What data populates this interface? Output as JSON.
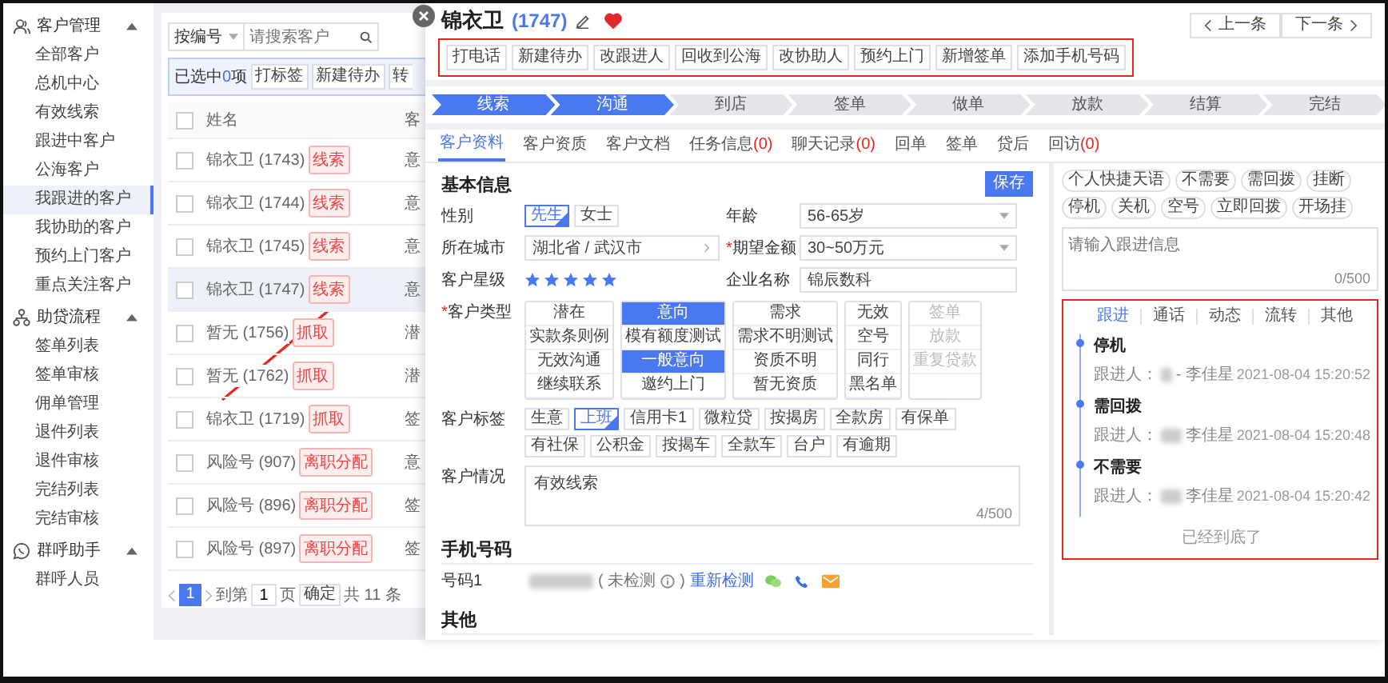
{
  "sidebar": {
    "groups": [
      {
        "title": "客户管理",
        "expanded": true,
        "items": [
          {
            "label": "全部客户",
            "selected": false
          },
          {
            "label": "总机中心",
            "selected": false
          },
          {
            "label": "有效线索",
            "selected": false
          },
          {
            "label": "跟进中客户",
            "selected": false
          },
          {
            "label": "公海客户",
            "selected": false
          },
          {
            "label": "我跟进的客户",
            "selected": true
          },
          {
            "label": "我协助的客户",
            "selected": false
          },
          {
            "label": "预约上门客户",
            "selected": false
          },
          {
            "label": "重点关注客户",
            "selected": false
          }
        ]
      },
      {
        "title": "助贷流程",
        "expanded": true,
        "items": [
          {
            "label": "签单列表",
            "selected": false
          },
          {
            "label": "签单审核",
            "selected": false
          },
          {
            "label": "佣单管理",
            "selected": false
          },
          {
            "label": "退件列表",
            "selected": false
          },
          {
            "label": "退件审核",
            "selected": false
          },
          {
            "label": "完结列表",
            "selected": false
          },
          {
            "label": "完结审核",
            "selected": false
          }
        ]
      },
      {
        "title": "群呼助手",
        "expanded": true,
        "items": [
          {
            "label": "群呼人员",
            "selected": false
          }
        ]
      }
    ]
  },
  "list": {
    "search_field": "按编号",
    "placeholder": "请搜索客户",
    "selection": {
      "text": "已选中",
      "count": "0",
      "unit": "项"
    },
    "actions": [
      "打标签",
      "新建待办",
      "转"
    ],
    "columns": [
      "姓名",
      "客"
    ],
    "select_all_checked": false,
    "rows": [
      {
        "name": "锦衣卫 (1743)",
        "tag": "线索",
        "column_3": "意",
        "checked": false,
        "selected": false
      },
      {
        "name": "锦衣卫 (1744)",
        "tag": "线索",
        "column_3": "意",
        "checked": false,
        "selected": false
      },
      {
        "name": "锦衣卫 (1745)",
        "tag": "线索",
        "column_3": "意",
        "checked": false,
        "selected": false
      },
      {
        "name": "锦衣卫 (1747)",
        "tag": "线索",
        "column_3": "意",
        "checked": false,
        "selected": true
      },
      {
        "name": "暂无 (1756)",
        "tag": "抓取",
        "column_3": "潜",
        "checked": false,
        "selected": false
      },
      {
        "name": "暂无 (1762)",
        "tag": "抓取",
        "column_3": "潜",
        "checked": false,
        "selected": false
      },
      {
        "name": "锦衣卫 (1719)",
        "tag": "抓取",
        "column_3": "签",
        "checked": false,
        "selected": false
      },
      {
        "name": "风险号 (907)",
        "tag": "离职分配",
        "column_3": "意",
        "checked": false,
        "selected": false
      },
      {
        "name": "风险号 (896)",
        "tag": "离职分配",
        "column_3": "签",
        "checked": false,
        "selected": false
      },
      {
        "name": "风险号 (897)",
        "tag": "离职分配",
        "column_3": "签",
        "checked": false,
        "selected": false
      }
    ],
    "pagination": {
      "page": "1",
      "goto_label": "到第",
      "goto_value": "1",
      "page_unit": "页",
      "confirm": "确定",
      "total": "共 11 条"
    }
  },
  "detail": {
    "title": "锦衣卫",
    "id": "(1747)",
    "favorite": true,
    "nav": [
      "上一条",
      "下一条"
    ],
    "actions": [
      "打电话",
      "新建待办",
      "改跟进人",
      "回收到公海",
      "改协助人",
      "预约上门",
      "新增签单",
      "添加手机号码"
    ],
    "steps": [
      {
        "label": "线索",
        "done": true
      },
      {
        "label": "沟通",
        "done": true
      },
      {
        "label": "到店",
        "done": false
      },
      {
        "label": "签单",
        "done": false
      },
      {
        "label": "做单",
        "done": false
      },
      {
        "label": "放款",
        "done": false
      },
      {
        "label": "结算",
        "done": false
      },
      {
        "label": "完结",
        "done": false
      }
    ],
    "tabs": [
      {
        "label": "客户资料",
        "selected": true
      },
      {
        "label": "客户资质",
        "selected": false
      },
      {
        "label": "客户文档",
        "selected": false
      },
      {
        "label": "任务信息",
        "count": "(0)",
        "selected": false
      },
      {
        "label": "聊天记录",
        "count": "(0)",
        "selected": false
      },
      {
        "label": "回单",
        "selected": false
      },
      {
        "label": "签单",
        "selected": false
      },
      {
        "label": "贷后",
        "selected": false
      },
      {
        "label": "回访",
        "count": "(0)",
        "selected": false
      }
    ],
    "form": {
      "section": "基本信息",
      "save": "保存",
      "gender": {
        "label": "性别",
        "options": [
          {
            "label": "先生",
            "selected": true
          },
          {
            "label": "女士",
            "selected": false
          }
        ]
      },
      "age": {
        "label": "年龄",
        "value": "56-65岁"
      },
      "city": {
        "label": "所在城市",
        "value": "湖北省 / 武汉市"
      },
      "amount": {
        "label": "期望金额",
        "required_mark": "*",
        "value": "30~50万元"
      },
      "rating": {
        "label": "客户星级",
        "stars": 5
      },
      "company": {
        "label": "企业名称",
        "value": "锦辰数科"
      },
      "customer_type": {
        "label": "客户类型",
        "required_mark": "*",
        "columns": [
          [
            {
              "label": "潜在",
              "selected": false,
              "disabled": false
            },
            {
              "label": "实款条则例",
              "selected": false,
              "disabled": false
            },
            {
              "label": "无效沟通",
              "selected": false,
              "disabled": false
            },
            {
              "label": "继续联系",
              "selected": false,
              "disabled": false
            }
          ],
          [
            {
              "label": "意向",
              "selected": true,
              "disabled": false
            },
            {
              "label": "模有额度测试",
              "selected": false,
              "disabled": false
            },
            {
              "label": "一般意向",
              "selected": true,
              "disabled": false
            },
            {
              "label": "邀约上门",
              "selected": false,
              "disabled": false
            }
          ],
          [
            {
              "label": "需求",
              "selected": false,
              "disabled": false
            },
            {
              "label": "需求不明测试",
              "selected": false,
              "disabled": false
            },
            {
              "label": "资质不明",
              "selected": false,
              "disabled": false
            },
            {
              "label": "暂无资质",
              "selected": false,
              "disabled": false
            }
          ],
          [
            {
              "label": "无效",
              "selected": false,
              "disabled": false
            },
            {
              "label": "空号",
              "selected": false,
              "disabled": false
            },
            {
              "label": "同行",
              "selected": false,
              "disabled": false
            },
            {
              "label": "黑名单",
              "selected": false,
              "disabled": false
            }
          ],
          [
            {
              "label": "签单",
              "selected": false,
              "disabled": true
            },
            {
              "label": "放款",
              "selected": false,
              "disabled": true
            },
            {
              "label": "重复贷款",
              "selected": false,
              "disabled": true
            }
          ]
        ]
      },
      "tags": {
        "label": "客户标签",
        "options": [
          {
            "label": "生意",
            "selected": false
          },
          {
            "label": "上班",
            "selected": true
          },
          {
            "label": "信用卡1",
            "selected": false
          },
          {
            "label": "微粒贷",
            "selected": false
          },
          {
            "label": "按揭房",
            "selected": false
          },
          {
            "label": "全款房",
            "selected": false
          },
          {
            "label": "有保单",
            "selected": false
          },
          {
            "label": "有社保",
            "selected": false
          },
          {
            "label": "公积金",
            "selected": false
          },
          {
            "label": "按揭车",
            "selected": false
          },
          {
            "label": "全款车",
            "selected": false
          },
          {
            "label": "台户",
            "selected": false
          },
          {
            "label": "有逾期",
            "selected": false
          }
        ]
      },
      "situation": {
        "label": "客户情况",
        "value": "有效线索",
        "counter": "4/500"
      }
    },
    "phones": {
      "section": "手机号码",
      "rows": [
        {
          "label": "号码1",
          "status": "( 未检测",
          "status_end": ")",
          "recheck": "重新检测"
        }
      ]
    },
    "other": {
      "section": "其他"
    },
    "followup": {
      "phrases": [
        "个人快捷天语",
        "不需要",
        "需回拨",
        "挂断",
        "停机",
        "关机",
        "空号",
        "立即回拨",
        "开场挂"
      ],
      "placeholder": "请输入跟进信息",
      "counter": "0/500",
      "tabs": [
        {
          "label": "跟进",
          "selected": true
        },
        {
          "label": "通话",
          "selected": false
        },
        {
          "label": "动态",
          "selected": false
        },
        {
          "label": "流转",
          "selected": false
        },
        {
          "label": "其他",
          "selected": false
        }
      ],
      "entries": [
        {
          "title": "停机",
          "person_label": "跟进人：",
          "person": "- 李佳星",
          "time": "2021-08-04 15:20:52"
        },
        {
          "title": "需回拨",
          "person_label": "跟进人：",
          "person": "李佳星",
          "time": "2021-08-04 15:20:48"
        },
        {
          "title": "不需要",
          "person_label": "跟进人：",
          "person": "李佳星",
          "time": "2021-08-04 15:20:42"
        }
      ],
      "end": "已经到底了"
    }
  }
}
